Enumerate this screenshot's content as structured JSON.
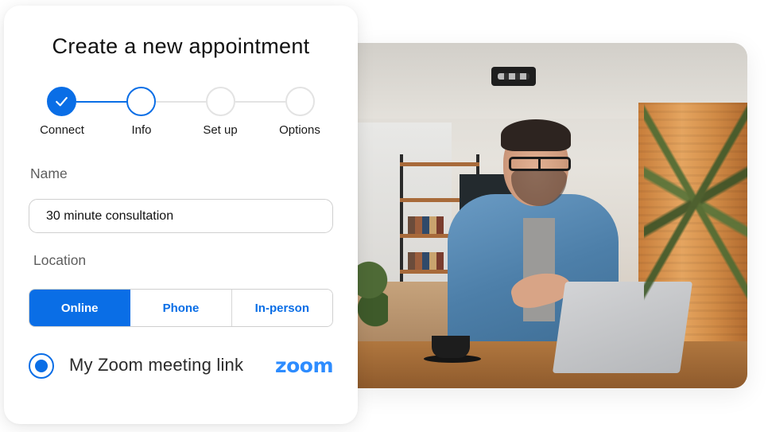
{
  "card": {
    "title": "Create a new appointment",
    "stepper": {
      "steps": [
        {
          "label": "Connect",
          "state": "completed",
          "icon": "check-icon"
        },
        {
          "label": "Info",
          "state": "active"
        },
        {
          "label": "Set up",
          "state": "upcoming"
        },
        {
          "label": "Options",
          "state": "upcoming"
        }
      ]
    },
    "name_field": {
      "label": "Name",
      "value": "30 minute consultation"
    },
    "location": {
      "label": "Location",
      "options": [
        "Online",
        "Phone",
        "In-person"
      ],
      "selected": "Online"
    },
    "meeting_option": {
      "label": "My Zoom meeting link",
      "selected": true,
      "brand_logo_text": "zoom"
    }
  },
  "photo": {
    "description": "Smiling man with glasses in denim shirt gesturing at laptop during video call"
  },
  "colors": {
    "accent": "#0a6ee6",
    "zoom_brand": "#2d8cff",
    "inactive_step": "#e3e3e3"
  }
}
